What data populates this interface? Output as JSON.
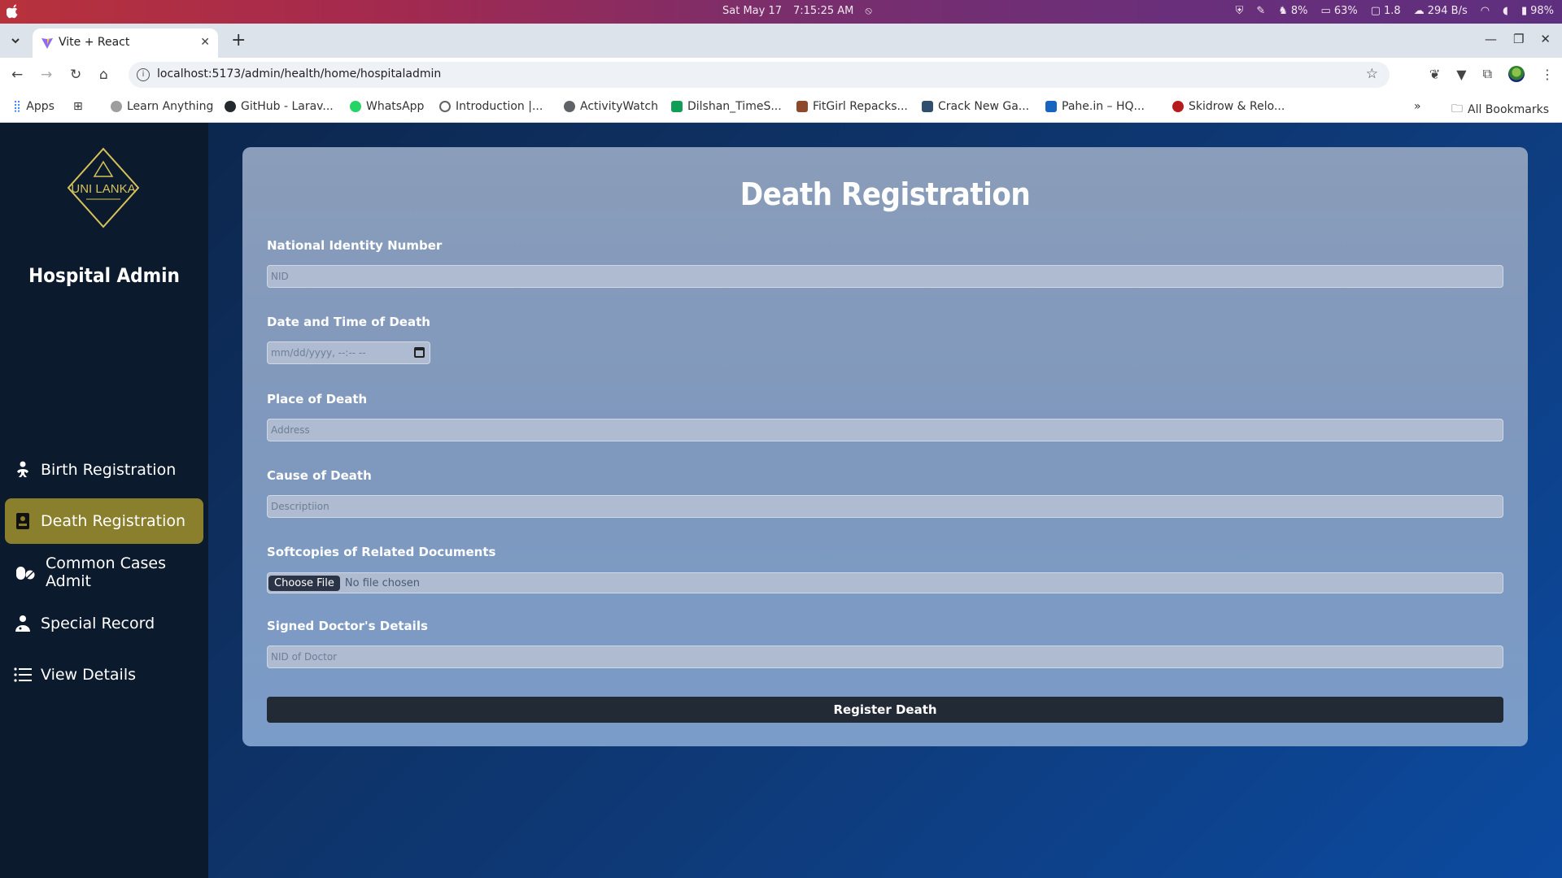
{
  "os": {
    "date": "Sat May 17",
    "time": "7:15:25 AM",
    "cpu": "8%",
    "battery_icon_pct": "63%",
    "load": "1.8",
    "net": "294 B/s",
    "battery": "98%"
  },
  "browser": {
    "tab_title": "Vite + React",
    "url": "localhost:5173/admin/health/home/hospitaladmin",
    "bookmarks": [
      {
        "label": "Apps",
        "color": "#4285f4"
      },
      {
        "label": "Learn Anything",
        "color": "#9e9e9e"
      },
      {
        "label": "GitHub - Larav...",
        "color": "#24292e"
      },
      {
        "label": "WhatsApp",
        "color": "#25d366"
      },
      {
        "label": "Introduction |...",
        "color": "#5f6368"
      },
      {
        "label": "ActivityWatch",
        "color": "#5f6368"
      },
      {
        "label": "Dilshan_TimeS...",
        "color": "#0f9d58"
      },
      {
        "label": "FitGirl Repacks...",
        "color": "#8d4a2b"
      },
      {
        "label": "Crack New Ga...",
        "color": "#2f4f6f"
      },
      {
        "label": "Pahe.in – HQ...",
        "color": "#1565c0"
      },
      {
        "label": "Skidrow & Relo...",
        "color": "#b71c1c"
      }
    ],
    "all_bookmarks": "All Bookmarks"
  },
  "sidebar": {
    "logo_text": "UNI LANKA",
    "title": "Hospital Admin",
    "items": [
      {
        "label": "Birth Registration",
        "icon": "baby-icon"
      },
      {
        "label": "Death Registration",
        "icon": "coffin-icon",
        "active": true
      },
      {
        "label": "Common Cases Admit",
        "icon": "pills-icon"
      },
      {
        "label": "Special Record",
        "icon": "doctor-icon"
      },
      {
        "label": "View Details",
        "icon": "list-icon"
      }
    ]
  },
  "form": {
    "title": "Death Registration",
    "nid_label": "National Identity Number",
    "nid_placeholder": "NID",
    "datetime_label": "Date and Time of Death",
    "datetime_placeholder": "mm/dd/yyyy, --:-- --",
    "place_label": "Place of Death",
    "place_placeholder": "Address",
    "cause_label": "Cause of Death",
    "cause_placeholder": "Descriptiion",
    "docs_label": "Softcopies of Related Documents",
    "choose_file": "Choose File",
    "no_file": "No file chosen",
    "doctor_label": "Signed Doctor's Details",
    "doctor_placeholder": "NID of Doctor",
    "submit": "Register Death"
  },
  "colors": {
    "active_nav": "#8a7f2c",
    "sidebar_bg": "#0c1a2e",
    "submit_bg": "#222a35"
  }
}
